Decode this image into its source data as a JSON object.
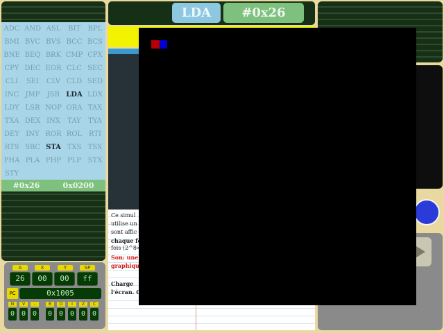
{
  "instructions": [
    "ADC",
    "AND",
    "ASL",
    "BIT",
    "BPL",
    "BMI",
    "BVC",
    "BVS",
    "BCC",
    "BCS",
    "BNE",
    "BEQ",
    "BRK",
    "CMP",
    "CPX",
    "CPY",
    "DEC",
    "EOR",
    "CLC",
    "SEC",
    "CLI",
    "SEI",
    "CLV",
    "CLD",
    "SED",
    "INC",
    "JMP",
    "JSR",
    "LDA",
    "LDX",
    "LDY",
    "LSR",
    "NOP",
    "ORA",
    "TAX",
    "TXA",
    "DEX",
    "INX",
    "TAY",
    "TYA",
    "DEY",
    "INY",
    "ROR",
    "ROL",
    "RTI",
    "RTS",
    "SBC",
    "STA",
    "TXS",
    "TSX",
    "PHA",
    "PLA",
    "PHP",
    "PLP",
    "STX",
    "STY"
  ],
  "left_status": {
    "value": "#0x26",
    "address": "0x0200"
  },
  "registers": {
    "labels": [
      "A",
      "X",
      "Y",
      "SP"
    ],
    "values": [
      "26",
      "00",
      "00",
      "ff"
    ],
    "pc_label": "PC",
    "pc_value": "0x1005",
    "flag_labels": [
      "N",
      "V",
      "-",
      "B",
      "D",
      "I",
      "Z",
      "C"
    ],
    "flag_values": [
      "0",
      "0",
      "0",
      "0",
      "0",
      "0",
      "0",
      "0"
    ]
  },
  "header": {
    "instruction": "LDA",
    "operand": "#0x26"
  },
  "text_panel": {
    "line1": "Ce simul",
    "line2": "utilise un",
    "line3": "sont affic",
    "line4": "chaque fo",
    "line5": "fois (2^8=",
    "line6": "Son: une",
    "line7": "graphiqu",
    "line8": "Charge",
    "line9": "l'écran. C"
  },
  "colors": {
    "accent_yellow": "#f3f300",
    "instruction_blue": "#8ec8e0",
    "operand_green": "#7ec07e",
    "register_dark_green": "#063b06"
  },
  "icons": [
    "play-icon",
    "blue-circle-icon"
  ]
}
